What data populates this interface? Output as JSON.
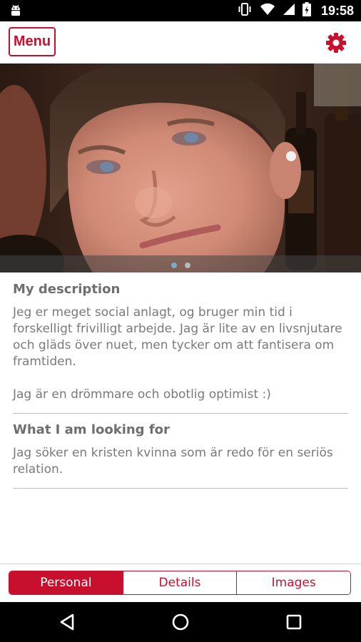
{
  "status_bar": {
    "time": "19:58",
    "icons": [
      "android-icon",
      "vibrate-icon",
      "wifi-icon",
      "signal-icon",
      "battery-icon"
    ]
  },
  "app_bar": {
    "menu_label": "Menu",
    "settings_icon": "gear-icon",
    "accent_color": "#c8102e"
  },
  "photo": {
    "page_indicator": {
      "count": 2,
      "active_index": 0
    }
  },
  "profile": {
    "description": {
      "title": "My description",
      "text": "Jeg er meget social anlagt, og bruger min tid i forskelligt frivilligt arbejde. Jag är lite av en livsnjutare och gläds över nuet, men tycker om att fantisera om framtiden.\n\nJag är en drömmare och obotlig optimist :)"
    },
    "looking_for": {
      "title": "What I am looking for",
      "text": "Jag söker en kristen kvinna som är redo för en seriös relation."
    }
  },
  "tabs": [
    {
      "label": "Personal",
      "active": true
    },
    {
      "label": "Details",
      "active": false
    },
    {
      "label": "Images",
      "active": false
    }
  ],
  "nav_bar": {
    "buttons": [
      "back-icon",
      "home-icon",
      "recents-icon"
    ]
  }
}
